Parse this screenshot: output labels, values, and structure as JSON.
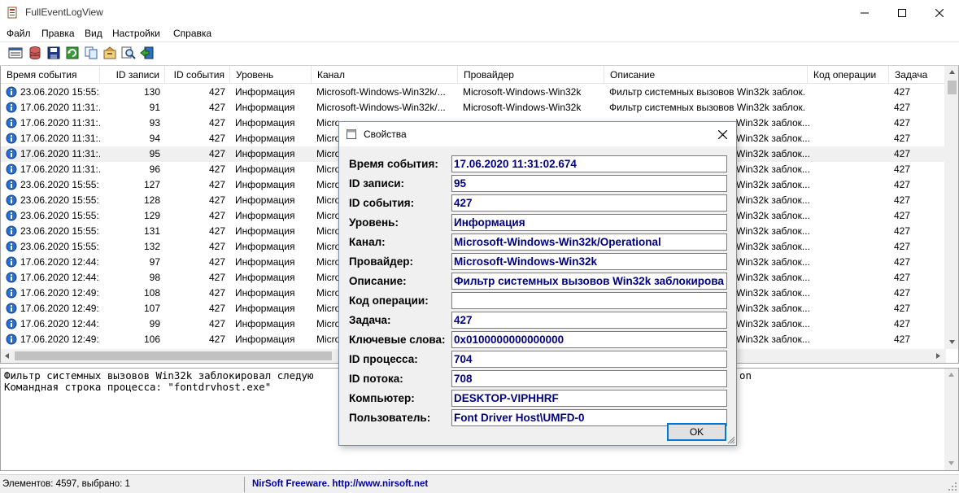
{
  "window": {
    "title": "FullEventLogView"
  },
  "menu": [
    "Файл",
    "Правка",
    "Вид",
    "Настройки",
    "Справка"
  ],
  "columns": [
    "Время события",
    "ID записи",
    "ID события",
    "Уровень",
    "Канал",
    "Провайдер",
    "Описание",
    "Код операции",
    "Задача"
  ],
  "rows": [
    {
      "time": "23.06.2020 15:55:...",
      "record": "130",
      "event": "427",
      "level": "Информация",
      "channel": "Microsoft-Windows-Win32k/...",
      "provider": "Microsoft-Windows-Win32k",
      "desc": "Фильтр системных вызовов Win32k заблок...",
      "task": "427"
    },
    {
      "time": "17.06.2020 11:31:...",
      "record": "91",
      "event": "427",
      "level": "Информация",
      "channel": "Microsoft-Windows-Win32k/...",
      "provider": "Microsoft-Windows-Win32k",
      "desc": "Фильтр системных вызовов Win32k заблок...",
      "task": "427"
    },
    {
      "time": "17.06.2020 11:31:...",
      "record": "93",
      "event": "427",
      "level": "Информация",
      "channel": "Micro",
      "provider": "",
      "desc": "Win32k заблок...",
      "task": "427"
    },
    {
      "time": "17.06.2020 11:31:...",
      "record": "94",
      "event": "427",
      "level": "Информация",
      "channel": "Micro",
      "provider": "",
      "desc": "Win32k заблок...",
      "task": "427"
    },
    {
      "time": "17.06.2020 11:31:...",
      "record": "95",
      "event": "427",
      "level": "Информация",
      "channel": "Micro",
      "provider": "",
      "desc": "Win32k заблок...",
      "task": "427"
    },
    {
      "time": "17.06.2020 11:31:...",
      "record": "96",
      "event": "427",
      "level": "Информация",
      "channel": "Micro",
      "provider": "",
      "desc": "Win32k заблок...",
      "task": "427"
    },
    {
      "time": "23.06.2020 15:55:...",
      "record": "127",
      "event": "427",
      "level": "Информация",
      "channel": "Micro",
      "provider": "",
      "desc": "Win32k заблок...",
      "task": "427"
    },
    {
      "time": "23.06.2020 15:55:...",
      "record": "128",
      "event": "427",
      "level": "Информация",
      "channel": "Micro",
      "provider": "",
      "desc": "Win32k заблок...",
      "task": "427"
    },
    {
      "time": "23.06.2020 15:55:...",
      "record": "129",
      "event": "427",
      "level": "Информация",
      "channel": "Micro",
      "provider": "",
      "desc": "Win32k заблок...",
      "task": "427"
    },
    {
      "time": "23.06.2020 15:55:...",
      "record": "131",
      "event": "427",
      "level": "Информация",
      "channel": "Micro",
      "provider": "",
      "desc": "Win32k заблок...",
      "task": "427"
    },
    {
      "time": "23.06.2020 15:55:...",
      "record": "132",
      "event": "427",
      "level": "Информация",
      "channel": "Micro",
      "provider": "",
      "desc": "Win32k заблок...",
      "task": "427"
    },
    {
      "time": "17.06.2020 12:44:...",
      "record": "97",
      "event": "427",
      "level": "Информация",
      "channel": "Micro",
      "provider": "",
      "desc": "Win32k заблок...",
      "task": "427"
    },
    {
      "time": "17.06.2020 12:44:...",
      "record": "98",
      "event": "427",
      "level": "Информация",
      "channel": "Micro",
      "provider": "",
      "desc": "Win32k заблок...",
      "task": "427"
    },
    {
      "time": "17.06.2020 12:49:...",
      "record": "108",
      "event": "427",
      "level": "Информация",
      "channel": "Micro",
      "provider": "",
      "desc": "Win32k заблок...",
      "task": "427"
    },
    {
      "time": "17.06.2020 12:49:...",
      "record": "107",
      "event": "427",
      "level": "Информация",
      "channel": "Micro",
      "provider": "",
      "desc": "Win32k заблок...",
      "task": "427"
    },
    {
      "time": "17.06.2020 12:44:...",
      "record": "99",
      "event": "427",
      "level": "Информация",
      "channel": "Micro",
      "provider": "",
      "desc": "Win32k заблок...",
      "task": "427"
    },
    {
      "time": "17.06.2020 12:49:...",
      "record": "106",
      "event": "427",
      "level": "Информация",
      "channel": "Micro",
      "provider": "",
      "desc": "Win32k заблок...",
      "task": "427"
    }
  ],
  "selected_row": 4,
  "description_pane": {
    "line1": "Фильтр системных вызовов Win32k заблокировал следую",
    "line1_tail": "on",
    "line2": "Командная строка процесса: \"fontdrvhost.exe\""
  },
  "status": {
    "left": "Элементов: 4597, выбрано: 1",
    "right": "NirSoft Freeware.  http://www.nirsoft.net"
  },
  "dialog": {
    "title": "Свойства",
    "ok_label": "OK",
    "fields": [
      {
        "label": "Время события:",
        "value": "17.06.2020 11:31:02.674"
      },
      {
        "label": "ID записи:",
        "value": "95"
      },
      {
        "label": "ID события:",
        "value": "427"
      },
      {
        "label": "Уровень:",
        "value": "Информация"
      },
      {
        "label": "Канал:",
        "value": "Microsoft-Windows-Win32k/Operational"
      },
      {
        "label": "Провайдер:",
        "value": "Microsoft-Windows-Win32k"
      },
      {
        "label": "Описание:",
        "value": "Фильтр системных вызовов Win32k заблокирова"
      },
      {
        "label": "Код операции:",
        "value": ""
      },
      {
        "label": "Задача:",
        "value": "427"
      },
      {
        "label": "Ключевые слова:",
        "value": "0x0100000000000000"
      },
      {
        "label": "ID процесса:",
        "value": "704"
      },
      {
        "label": "ID потока:",
        "value": "708"
      },
      {
        "label": "Компьютер:",
        "value": "DESKTOP-VIPHHRF"
      },
      {
        "label": "Пользователь:",
        "value": "Font Driver Host\\UMFD-0"
      }
    ]
  },
  "colors": {
    "accent": "#0078d7",
    "value_text": "#000080",
    "link": "#0000a0"
  }
}
